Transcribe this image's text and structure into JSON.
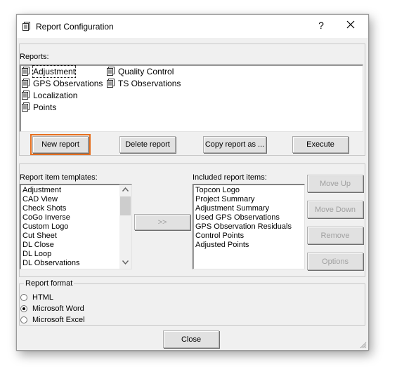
{
  "window": {
    "title": "Report Configuration",
    "help_label": "?"
  },
  "reports": {
    "label": "Reports:",
    "items": [
      {
        "label": "Adjustment",
        "selected": true
      },
      {
        "label": "GPS Observations"
      },
      {
        "label": "Localization"
      },
      {
        "label": "Points"
      },
      {
        "label": "Quality Control"
      },
      {
        "label": "TS Observations"
      }
    ],
    "buttons": {
      "new": "New report",
      "delete": "Delete report",
      "copy": "Copy report as ...",
      "execute": "Execute"
    }
  },
  "templates": {
    "label": "Report item templates:",
    "items": [
      "Adjustment",
      "CAD View",
      "Check Shots",
      "CoGo Inverse",
      "Custom Logo",
      "Cut Sheet",
      "DL Close",
      "DL Loop",
      "DL Observations"
    ]
  },
  "add_button": ">>",
  "included": {
    "label": "Included report items:",
    "items": [
      "Topcon Logo",
      "Project Summary",
      "Adjustment Summary",
      "Used GPS Observations",
      "GPS Observation Residuals",
      "Control Points",
      "Adjusted Points"
    ]
  },
  "side_buttons": {
    "move_up": "Move Up",
    "move_down": "Move Down",
    "remove": "Remove",
    "options": "Options"
  },
  "format": {
    "label": "Report format",
    "options": [
      {
        "label": "HTML",
        "checked": false
      },
      {
        "label": "Microsoft Word",
        "checked": true
      },
      {
        "label": "Microsoft Excel",
        "checked": false
      }
    ]
  },
  "close_label": "Close",
  "colors": {
    "focus_outline": "#e66f1f",
    "dialog_bg": "#f0f0f0"
  }
}
